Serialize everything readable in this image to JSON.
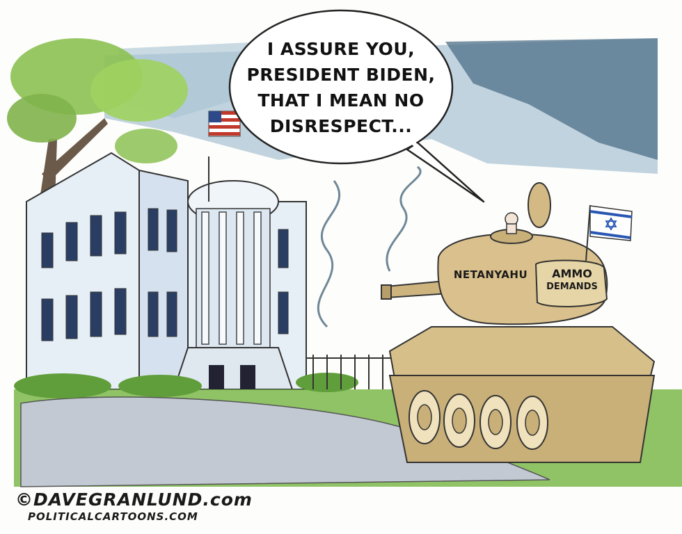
{
  "speech_bubble": {
    "lines": [
      "I ASSURE YOU,",
      "PRESIDENT BIDEN,",
      "THAT I MEAN NO",
      "DISRESPECT..."
    ]
  },
  "tank": {
    "turret_label": "NETANYAHU",
    "ammo_label_line1": "AMMO",
    "ammo_label_line2": "DEMANDS"
  },
  "credits": {
    "line1": "©DAVEGRANLUND.com",
    "line2": "POLITICALCARTOONS.COM"
  },
  "colors": {
    "sky": "#5a7f99",
    "white_house": "#e6eef6",
    "tank": "#d7bf8a",
    "grass": "#7bb84a",
    "tree": "#8cc152",
    "path": "#c2c9d2"
  },
  "icons": [
    "us-flag-icon",
    "israel-flag-icon",
    "star-of-david-icon"
  ]
}
